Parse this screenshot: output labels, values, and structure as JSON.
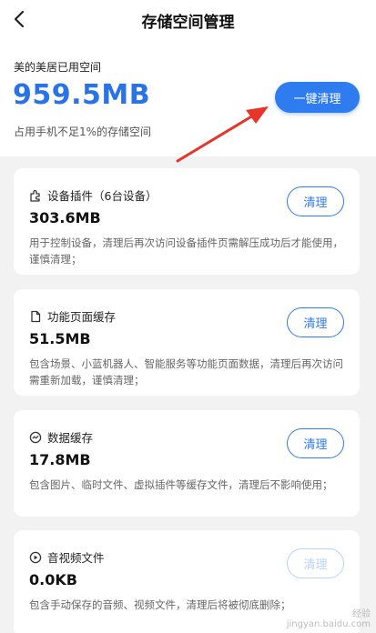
{
  "header": {
    "title": "存储空间管理",
    "back_icon": "chevron-left-icon"
  },
  "summary": {
    "label": "美的美居已用空间",
    "value": "959.5MB",
    "sub": "占用手机不足1%的存储空间",
    "clean_all_label": "一键清理"
  },
  "cards": [
    {
      "icon": "puzzle-icon",
      "title": "设备插件（6台设备）",
      "size": "303.6MB",
      "desc": "用于控制设备，清理后再次访问设备插件页需解压成功后才能使用，谨慎清理；",
      "button": "清理",
      "enabled": true
    },
    {
      "icon": "file-icon",
      "title": "功能页面缓存",
      "size": "51.5MB",
      "desc": "包含场景、小蓝机器人、智能服务等功能页面数据，清理后再次访问需重新加载，谨慎清理；",
      "button": "清理",
      "enabled": true
    },
    {
      "icon": "chart-circle-icon",
      "title": "数据缓存",
      "size": "17.8MB",
      "desc": "包含图片、临时文件、虚拟插件等缓存文件，清理后不影响使用；",
      "button": "清理",
      "enabled": true
    },
    {
      "icon": "play-circle-icon",
      "title": "音视频文件",
      "size": "0.0KB",
      "desc": "包含手动保存的音频、视频文件，清理后将被彻底删除；",
      "button": "清理",
      "enabled": false
    }
  ],
  "colors": {
    "accent": "#2f7bf0",
    "value": "#2a73e6",
    "annotation_arrow": "#e8342a"
  },
  "watermark": {
    "line1": "经验",
    "line2": "jingyan.baidu.com"
  }
}
